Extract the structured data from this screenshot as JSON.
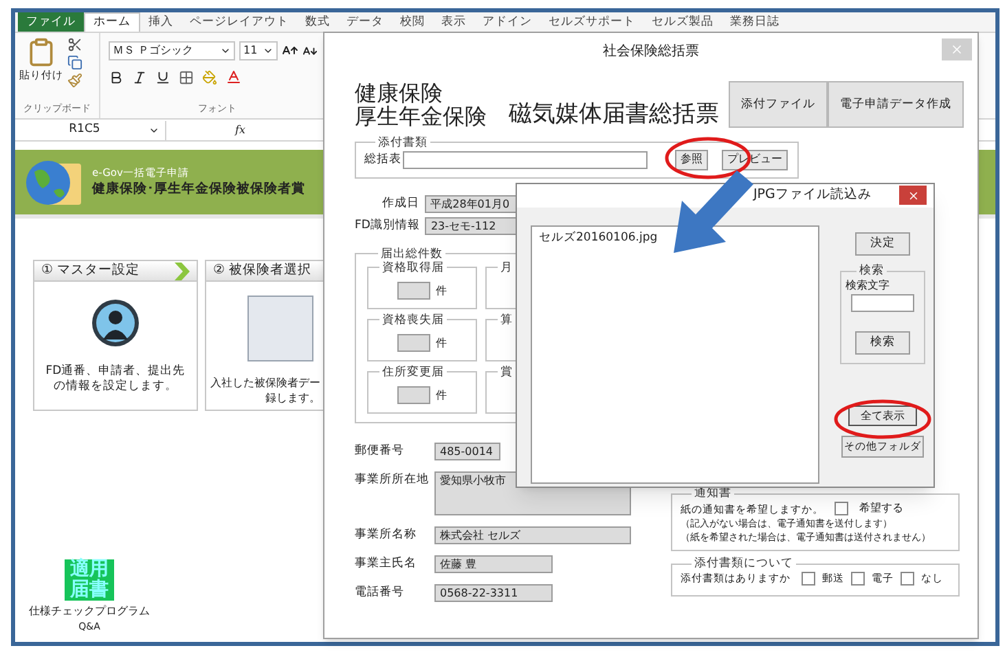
{
  "excel": {
    "tabs": [
      {
        "label": "ファイル",
        "kind": "file",
        "selected": false
      },
      {
        "label": "ホーム",
        "kind": "tab",
        "selected": true
      },
      {
        "label": "挿入",
        "kind": "tab",
        "selected": false
      },
      {
        "label": "ページレイアウト",
        "kind": "tab",
        "selected": false
      },
      {
        "label": "数式",
        "kind": "tab",
        "selected": false
      },
      {
        "label": "データ",
        "kind": "tab",
        "selected": false
      },
      {
        "label": "校閲",
        "kind": "tab",
        "selected": false
      },
      {
        "label": "表示",
        "kind": "tab",
        "selected": false
      },
      {
        "label": "アドイン",
        "kind": "tab",
        "selected": false
      },
      {
        "label": "セルズサポート",
        "kind": "tab",
        "selected": false
      },
      {
        "label": "セルズ製品",
        "kind": "tab",
        "selected": false
      },
      {
        "label": "業務日誌",
        "kind": "tab",
        "selected": false
      }
    ],
    "ribbon": {
      "paste_label": "貼り付け",
      "clipboard_group": "クリップボード",
      "font_name": "ＭＳ Ｐゴシック",
      "font_size": "11",
      "font_group": "フォント"
    },
    "formula_bar": {
      "name_box": "R1C5",
      "fx": "fx"
    },
    "banner": {
      "subtitle": "e-Gov一括電子申請",
      "title": "健康保険･厚生年金保険被保険者賞"
    },
    "cards": [
      {
        "kind": "avatar",
        "step": "① マスター設定",
        "lines": [
          "FD通番、申請者、提出先の情報を設定します。"
        ]
      },
      {
        "kind": "screenshot",
        "step": "② 被保険者選択",
        "lines": [
          "入社した被保険者デー",
          "録します。"
        ]
      }
    ],
    "tool": {
      "badge": "適用届書",
      "label": "仕様チェックプログラム",
      "sublabel": "Q&A"
    }
  },
  "dialog": {
    "title": "社会保険総括票",
    "heading_lines": [
      "健康保険",
      "厚生年金保険"
    ],
    "form_title": "磁気媒体届書総括票",
    "buttons": [
      "添付ファイル",
      "電子申請データ作成"
    ],
    "attachments": {
      "legend": "添付書類",
      "label": "総括表",
      "browse": "参照",
      "preview": "プレビュー"
    },
    "fields": [
      {
        "label": "作成日",
        "value": "平成28年01月0"
      },
      {
        "label": "FD識別情報",
        "value": "23-セモ-112"
      }
    ],
    "counts": {
      "legend": "届出総件数",
      "groups": [
        {
          "legend": "資格取得届",
          "unit": "件"
        },
        {
          "legend": "月"
        },
        {
          "legend": "資格喪失届",
          "unit": "件"
        },
        {
          "legend": "算"
        },
        {
          "legend": "住所変更届",
          "unit": "件"
        },
        {
          "legend": "賞"
        }
      ]
    },
    "office": [
      {
        "label": "郵便番号",
        "value": "485-0014",
        "kind": "short"
      },
      {
        "label": "事業所所在地",
        "value": "愛知県小牧市",
        "kind": "multiline"
      },
      {
        "label": "事業所名称",
        "value": "株式会社 セルズ",
        "kind": "wide"
      },
      {
        "label": "事業主氏名",
        "value": "佐藤 豊",
        "kind": "medium"
      },
      {
        "label": "電話番号",
        "value": "0568-22-3311",
        "kind": "medium"
      }
    ],
    "notice": {
      "legend": "通知書",
      "question": "紙の通知書を希望しますか。",
      "option": {
        "label": "希望する",
        "checked": false
      },
      "notes": [
        "（記入がない場合は、電子通知書を送付します）",
        "（紙を希望された場合は、電子通知書は送付されません）"
      ]
    },
    "attached_docs": {
      "legend": "添付書類について",
      "question": "添付書類はありますか",
      "options": [
        {
          "label": "郵送",
          "checked": false
        },
        {
          "label": "電子",
          "checked": false
        },
        {
          "label": "なし",
          "checked": false
        }
      ]
    }
  },
  "file_dialog": {
    "title": "JPGファイル読込み",
    "files": [
      "セルズ20160106.jpg"
    ],
    "ok": "決定",
    "search": {
      "legend": "検索",
      "label": "検索文字",
      "button": "検索"
    },
    "show_all": "全て表示",
    "other_folder": "その他フォルダ"
  }
}
